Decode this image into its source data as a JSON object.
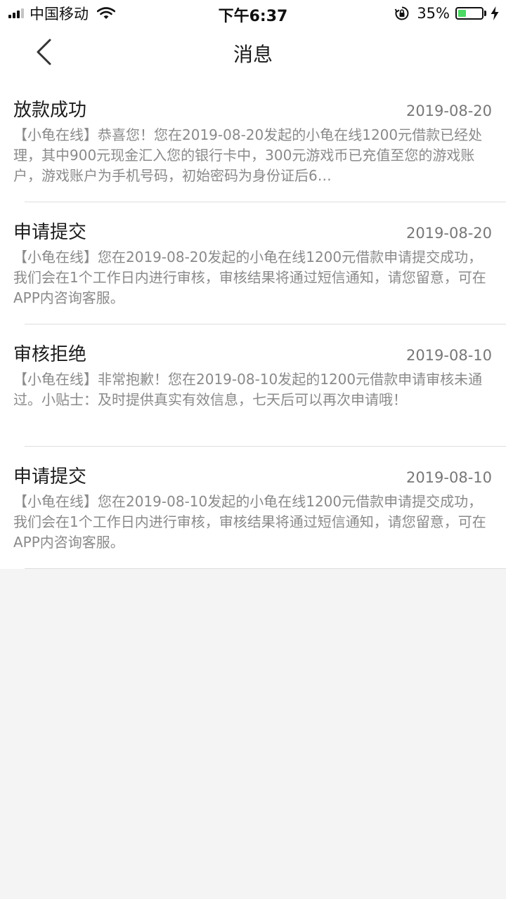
{
  "status_bar": {
    "carrier": "中国移动",
    "time": "下午6:37",
    "battery_percent": "35%",
    "battery_level": 0.35,
    "signal_bars": 3,
    "colors": {
      "battery_fill": "#4cd964"
    },
    "icons": [
      "signal-icon",
      "wifi-icon",
      "rotation-lock-icon",
      "battery-icon",
      "charging-icon"
    ]
  },
  "nav": {
    "title": "消息",
    "back_icon": "chevron-left-icon"
  },
  "messages": [
    {
      "title": "放款成功",
      "date": "2019-08-20",
      "body": "【小龟在线】恭喜您！您在2019-08-20发起的小龟在线1200元借款已经处理，其中900元现金汇入您的银行卡中，300元游戏币已充值至您的游戏账户，游戏账户为手机号码，初始密码为身份证后6…"
    },
    {
      "title": "申请提交",
      "date": "2019-08-20",
      "body": "【小龟在线】您在2019-08-20发起的小龟在线1200元借款申请提交成功，我们会在1个工作日内进行审核，审核结果将通过短信通知，请您留意，可在APP内咨询客服。"
    },
    {
      "title": "审核拒绝",
      "date": "2019-08-10",
      "body": "【小龟在线】非常抱歉！您在2019-08-10发起的1200元借款申请审核未通过。小贴士：及时提供真实有效信息，七天后可以再次申请哦！"
    },
    {
      "title": "申请提交",
      "date": "2019-08-10",
      "body": "【小龟在线】您在2019-08-10发起的小龟在线1200元借款申请提交成功，我们会在1个工作日内进行审核，审核结果将通过短信通知，请您留意，可在APP内咨询客服。"
    }
  ]
}
